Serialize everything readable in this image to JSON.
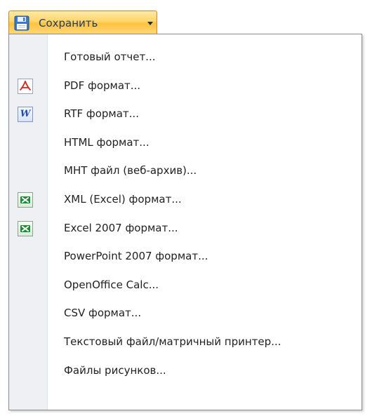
{
  "toolbar": {
    "save_label": "Сохранить",
    "save_icon": "floppy-disk-icon",
    "dropdown_icon": "dropdown-arrow-icon"
  },
  "menu": {
    "items": [
      {
        "label": "Готовый отчет...",
        "icon": ""
      },
      {
        "label": "PDF формат...",
        "icon": "pdf-icon"
      },
      {
        "label": "RTF формат...",
        "icon": "word-icon"
      },
      {
        "label": "HTML формат...",
        "icon": ""
      },
      {
        "label": "MHT файл (веб-архив)...",
        "icon": ""
      },
      {
        "label": "XML (Excel) формат...",
        "icon": "excel-icon"
      },
      {
        "label": "Excel 2007 формат...",
        "icon": "excel-icon"
      },
      {
        "label": "PowerPoint 2007 формат...",
        "icon": ""
      },
      {
        "label": "OpenOffice Calc...",
        "icon": ""
      },
      {
        "label": "CSV формат...",
        "icon": ""
      },
      {
        "label": "Текстовый файл/матричный принтер...",
        "icon": ""
      },
      {
        "label": "Файлы рисунков...",
        "icon": ""
      }
    ]
  },
  "colors": {
    "button_gradient_top": "#ffe9a8",
    "button_gradient_bottom": "#ffc23d",
    "button_border": "#c28a2c",
    "button_text": "#1e3b6e",
    "menu_border": "#8c8c8c",
    "gutter": "#eef0f3",
    "pdf_red": "#d0261d",
    "word_blue": "#1f4fb8",
    "excel_green": "#1e8a3a"
  }
}
